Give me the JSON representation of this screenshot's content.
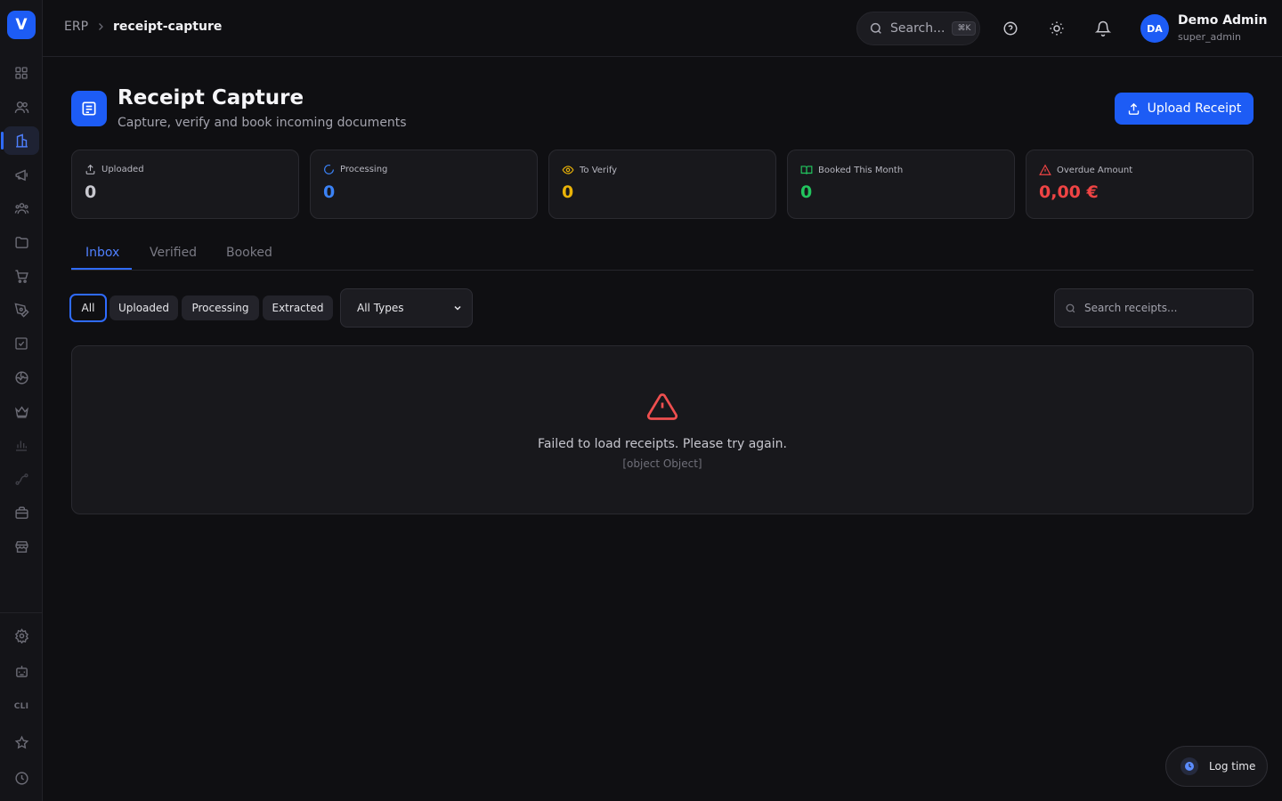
{
  "app": {
    "logo_letter": "V"
  },
  "sidebar": {
    "items": [
      {
        "name": "dashboard",
        "icon": "grid-icon"
      },
      {
        "name": "contacts",
        "icon": "users-icon"
      },
      {
        "name": "erp",
        "icon": "building-icon",
        "active": true
      },
      {
        "name": "marketing",
        "icon": "megaphone-icon"
      },
      {
        "name": "team",
        "icon": "team-icon"
      },
      {
        "name": "files",
        "icon": "folder-icon"
      },
      {
        "name": "shop",
        "icon": "cart-icon"
      },
      {
        "name": "sign",
        "icon": "pen-icon"
      },
      {
        "name": "tasks",
        "icon": "check-square-icon"
      },
      {
        "name": "web",
        "icon": "globe-icon"
      },
      {
        "name": "premium",
        "icon": "crown-icon"
      },
      {
        "name": "reports",
        "icon": "bar-chart-icon"
      },
      {
        "name": "workflows",
        "icon": "route-icon"
      },
      {
        "name": "jobs",
        "icon": "briefcase-icon"
      },
      {
        "name": "store",
        "icon": "store-icon"
      }
    ],
    "bottom_items": [
      {
        "name": "settings",
        "icon": "gear-icon"
      },
      {
        "name": "bot",
        "icon": "bot-icon"
      },
      {
        "name": "cli",
        "label": "CLI"
      },
      {
        "name": "favorites",
        "icon": "star-icon"
      },
      {
        "name": "history",
        "icon": "clock-icon"
      }
    ]
  },
  "topbar": {
    "breadcrumb_root": "ERP",
    "breadcrumb_current": "receipt-capture",
    "search_label": "Search...",
    "search_shortcut": "⌘K",
    "user_initials": "DA",
    "user_name": "Demo Admin",
    "user_role": "super_admin"
  },
  "header": {
    "title": "Receipt Capture",
    "subtitle": "Capture, verify and book incoming documents",
    "upload_label": "Upload Receipt"
  },
  "stats": [
    {
      "label": "Uploaded",
      "value": "0",
      "color": "#c8c8cf",
      "icon": "upload-icon"
    },
    {
      "label": "Processing",
      "value": "0",
      "color": "#3b82f6",
      "icon": "spinner-icon"
    },
    {
      "label": "To Verify",
      "value": "0",
      "color": "#eab308",
      "icon": "eye-icon"
    },
    {
      "label": "Booked This Month",
      "value": "0",
      "color": "#22c55e",
      "icon": "book-icon"
    },
    {
      "label": "Overdue Amount",
      "value": "0,00 €",
      "color": "#ef4444",
      "icon": "warning-icon"
    }
  ],
  "tabs": [
    "Inbox",
    "Verified",
    "Booked"
  ],
  "filters": {
    "chips": [
      "All",
      "Uploaded",
      "Processing",
      "Extracted"
    ],
    "type_select": "All Types",
    "search_placeholder": "Search receipts..."
  },
  "error": {
    "message": "Failed to load receipts. Please try again.",
    "detail": "[object Object]"
  },
  "logtime": {
    "label": "Log time"
  }
}
